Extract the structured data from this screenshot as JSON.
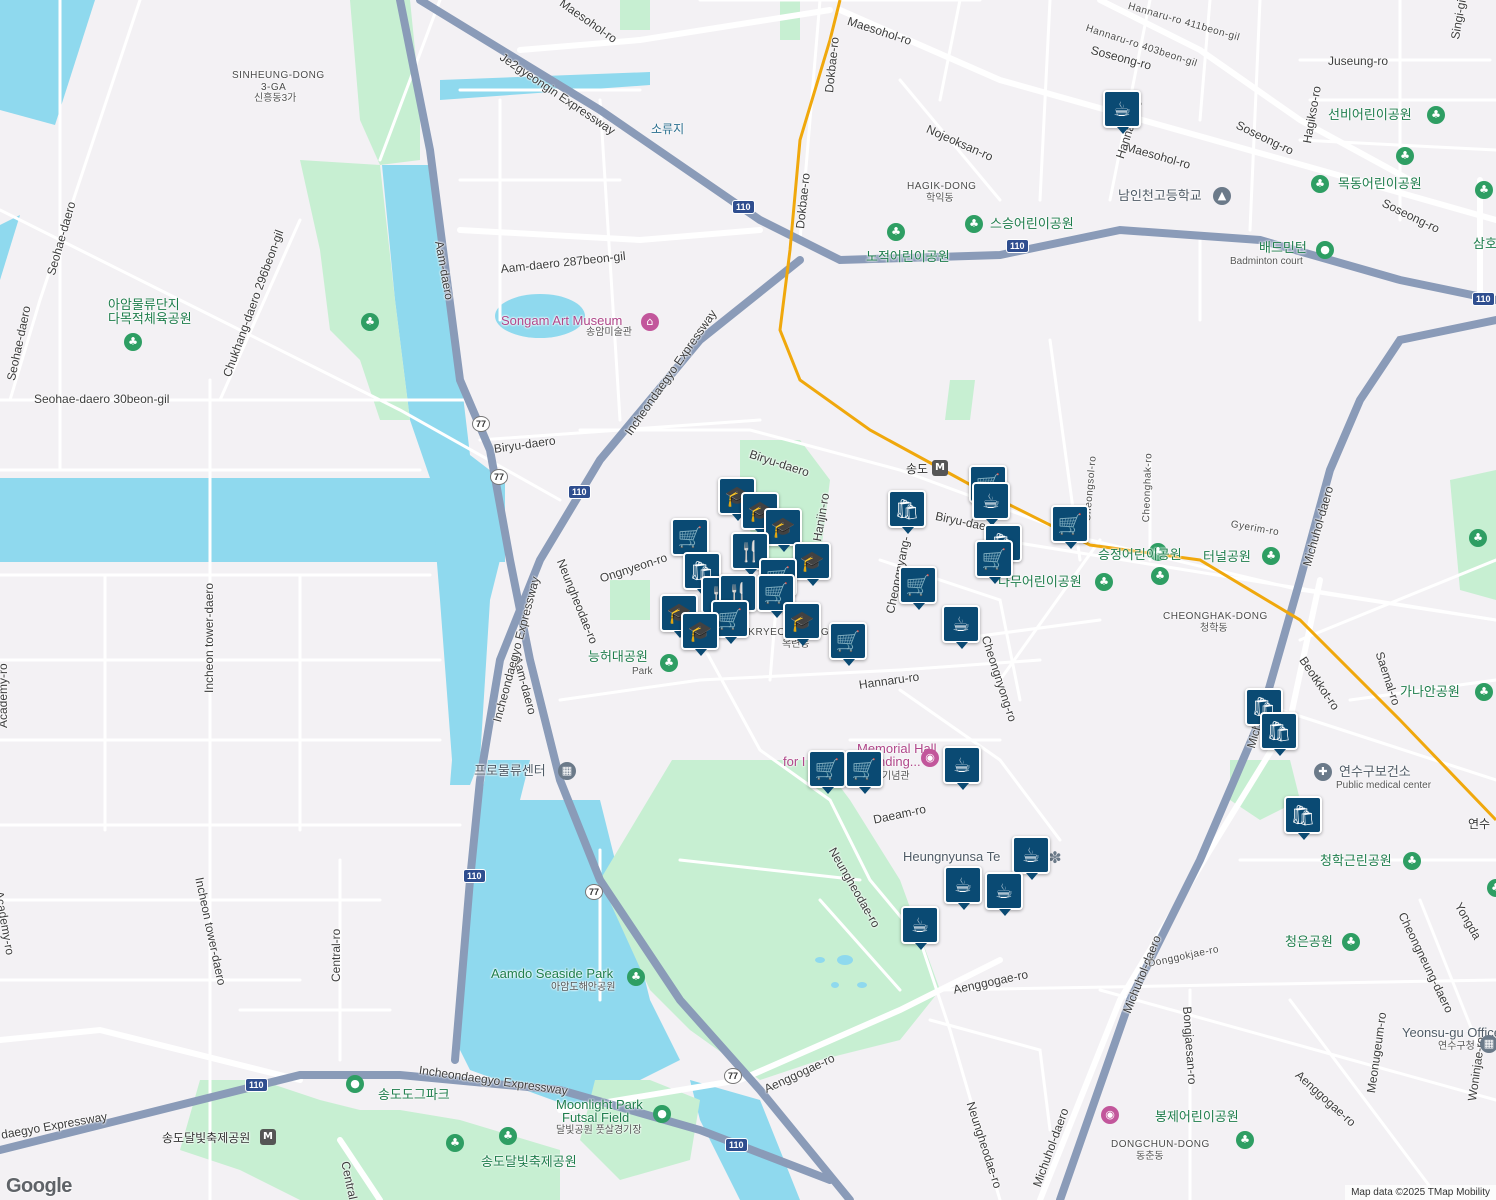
{
  "map": {
    "attribution": "Map data ©2025 TMap Mobility",
    "logo": "Google"
  },
  "roads": {
    "maesohol_ro_w": "Maesohol-ro",
    "maesohol_ro_ne": "Maesohol-ro",
    "maesohol_ro_e": "Maesohol-ro",
    "je2gyeongin": "Je2gyeongin Expressway",
    "dokbae_ro_n": "Dokbae-ro",
    "dokbae_ro_s": "Dokbae-ro",
    "aam_daero_n": "Aam-daero",
    "aam_daero_s": "Aam-daero",
    "aam_daero_287": "Aam-daero 287beon-gil",
    "seohae_daero": "Seohae-daero",
    "seohae_daero_30": "Seohae-daero 30beon-gil",
    "chukhang_296": "Chukhang-daero 296beon-gil",
    "biryu_daero_w": "Biryu-daero",
    "biryu_daero_c": "Biryu-daero",
    "biryu_daero_e": "Biryu-dae",
    "incheondaegyo_n": "Incheondaegyo Expressway",
    "incheondaegyo_mid": "Incheondaegyo Expressway",
    "incheondaegyo_s": "Incheondaegyo Expressway",
    "incheondaegyo_sw": "daegyo Expressway",
    "ongnyeon_ro": "Ongnyeon-ro",
    "neungheodae_n": "Neungheodae-ro",
    "neungheodae_mid": "Neungheodae-ro",
    "neungheodae_s": "Neungheodae-ro",
    "incheon_tower_n": "Incheon tower-daero",
    "incheon_tower_s": "Incheon tower-daero",
    "academy_n": "Academy-ro",
    "academy_s": "Academy-ro",
    "central_ro_n": "Central-ro",
    "central_ro_s": "Central",
    "hannaru_ro": "Hannaru-ro",
    "hannaru_ro_n": "Hannaru-ro",
    "hannaru_411": "Hannaru-ro 411beon-gil",
    "hannaru_403": "Hannaru-ro 403beon-gil",
    "soseong_ro_n": "Soseong-ro",
    "soseong_ro_c": "Soseong-ro",
    "soseong_ro_e": "Soseong-ro",
    "juseung_ro": "Juseung-ro",
    "hagikso_ro": "Hagikso-ro",
    "singi_gil": "Singi-gil",
    "nojeoksan_ro": "Nojeoksan-ro",
    "hanjin_ro": "Hanjin-ro",
    "cheongnyang_ro": "Cheongnyang-",
    "cheongnyong_ro": "Cheongnyong-ro",
    "cheongsol_ro": "Cheongsol-ro",
    "cheonghak_ro": "Cheonghak-ro",
    "gyerim_ro": "Gyerim-ro",
    "michuhol_daero_n": "Michuhol-daero",
    "michuhol_daero_c": "Michuh",
    "michuhol_daero_s1": "Michuhol-daero",
    "michuhol_daero_s2": "Michuhol-daero",
    "saemal_ro": "Saemal-ro",
    "beotkkot_ro": "Beotkkot-ro",
    "daeam_ro": "Daeam-ro",
    "donggokjae_ro": "Donggokjae-ro",
    "bongjaesan_ro": "Bongjaesan-ro",
    "aenggogae_ro_c": "Aenggogae-ro",
    "aenggogae_ro_w": "Aenggogae-ro",
    "aenggogae_ro_e": "Aenggogae-ro",
    "cheongneung_daero": "Cheongneung-daero",
    "meonugeum_ro": "Meonugeum-ro",
    "woninjae_ro": "Woninjae-ro",
    "yongdam": "Yongda"
  },
  "places": {
    "sinheung_dong": "SINHEUNG-DONG",
    "sinheung_3ga": "3-GA",
    "sinheung_ko": "신흥동3가",
    "hagik_dong": "HAGIK-DONG",
    "hagik_ko": "학익동",
    "okryeon_dong": "OKRYEON-DONG",
    "okryeon_ko": "옥련동",
    "cheonghak_dong": "CHEONGHAK-DONG",
    "cheonghak_ko": "청학동",
    "dongchun_dong": "DONGCHUN-DONG",
    "dongchun_ko": "동춘동",
    "soryuji": "소류지",
    "songdo_station": "송도",
    "yeonsu_partial": "연수",
    "samho_partial": "삼호"
  },
  "pois": {
    "songam_museum": "Songam Art Museum",
    "songam_museum_ko": "송암미술관",
    "aam_logistics_park_1": "아암물류단지",
    "aam_logistics_park_2": "다목적체육공원",
    "neungheo_park": "능허대공원",
    "neungheo_park_en": "Park",
    "prologis_center": "프로물류센터",
    "aamdo_seaside_park": "Aamdo Seaside Park",
    "aamdo_seaside_park_ko": "아암도해안공원",
    "songdo_dog_park": "송도도그파크",
    "songdo_moonlight_festival_park_station": "송도달빛축제공원",
    "songdo_moonlight_festival_park": "송도달빛축제공원",
    "moonlight_futsal_1": "Moonlight Park",
    "moonlight_futsal_2": "Futsal Field",
    "moonlight_futsal_ko": "달빛공원 풋살경기장",
    "memorial_hall_1": "Memorial Hall",
    "memorial_hall_2": "for I",
    "memorial_hall_3": "nding...",
    "memorial_hall_ko": "기념관",
    "heungnyunsa": "Heungnyunsa Te",
    "seungjeong_park": "승정어린이공원",
    "tunnel_park": "터널공원",
    "damu_park": "다무어린이공원",
    "seungeo_park": "스승어린이공원",
    "nojeok_park": "노적어린이공원",
    "namin_school": "남인천고등학교",
    "badminton_ko": "배드민턴",
    "badminton_en": "Badminton court",
    "seonbi_park": "선비어린이공원",
    "mokdong_park": "목동어린이공원",
    "gaanan_park": "가나안공원",
    "yeonsu_health_center": "연수구보건소",
    "public_medical_center": "Public medical center",
    "cheonghakgeunrin_park": "청학근린공원",
    "cheongeun_park": "청은공원",
    "bongje_park": "봉제어린이공원",
    "yeonsu_office": "Yeonsu-gu Office",
    "yeonsu_office_ko": "연수구청"
  },
  "shields": {
    "e110": "110",
    "e77": "77"
  },
  "markers": [
    {
      "icon": "coffee-icon"
    },
    {
      "icon": "shopping-bag-icon"
    },
    {
      "icon": "shopping-cart-icon"
    },
    {
      "icon": "graduation-cap-icon"
    },
    {
      "icon": "restaurant-icon"
    }
  ]
}
